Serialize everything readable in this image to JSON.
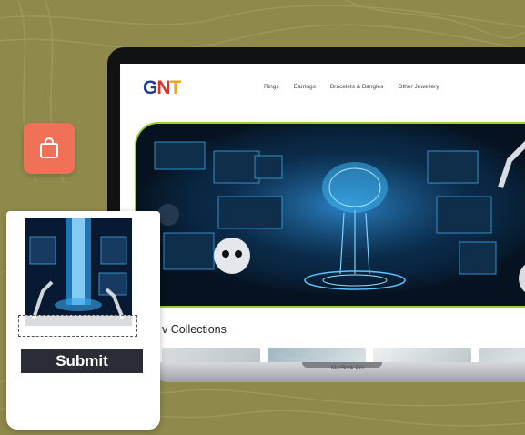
{
  "nav": {
    "logo": {
      "g": "G",
      "n": "N",
      "t": "T"
    },
    "links": [
      "Rings",
      "Earrings",
      "Bracelets & Bangles",
      "Other Jewellery"
    ]
  },
  "collections": {
    "title": "v Collections"
  },
  "laptop": {
    "model_label": "MacBook Pro"
  },
  "card": {
    "submit_label": "Submit"
  },
  "colors": {
    "background": "#8f8a4c",
    "bag_button": "#ef7157",
    "submit_button": "#2a2d36",
    "hero_border": "#9bcf3a"
  },
  "icons": {
    "bag": "shopping-bag-icon"
  }
}
